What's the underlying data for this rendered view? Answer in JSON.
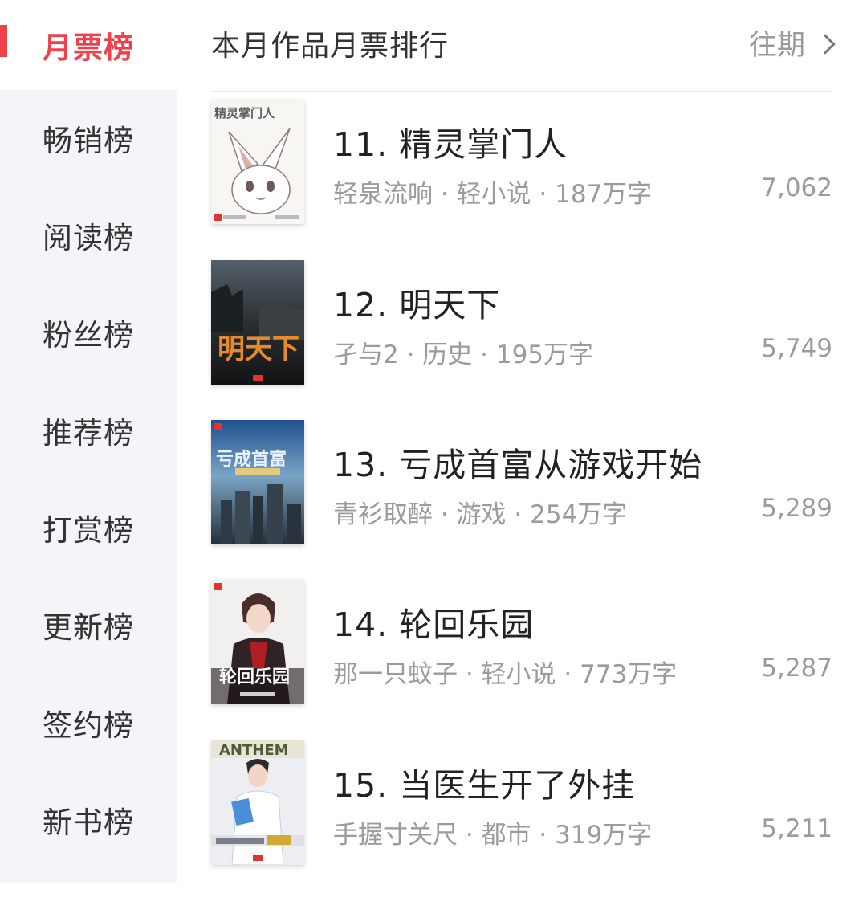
{
  "sidebar": {
    "items": [
      {
        "label": "月票榜",
        "active": true
      },
      {
        "label": "畅销榜"
      },
      {
        "label": "阅读榜"
      },
      {
        "label": "粉丝榜"
      },
      {
        "label": "推荐榜"
      },
      {
        "label": "打赏榜"
      },
      {
        "label": "更新榜"
      },
      {
        "label": "签约榜"
      },
      {
        "label": "新书榜"
      }
    ]
  },
  "header": {
    "title": "本月作品月票排行",
    "history_label": "往期"
  },
  "books": [
    {
      "title": "11. 精灵掌门人",
      "meta": "轻泉流响 · 轻小说 · 187万字",
      "votes": "7,062",
      "cover_text": "精灵掌门人"
    },
    {
      "title": "12. 明天下",
      "meta": "孑与2 · 历史 · 195万字",
      "votes": "5,749",
      "cover_text": "明天下"
    },
    {
      "title": "13. 亏成首富从游戏开始",
      "meta": "青衫取醉 · 游戏 · 254万字",
      "votes": "5,289",
      "cover_text": "亏成首富"
    },
    {
      "title": "14. 轮回乐园",
      "meta": "那一只蚊子 · 轻小说 · 773万字",
      "votes": "5,287",
      "cover_text": "轮回乐园"
    },
    {
      "title": "15. 当医生开了外挂",
      "meta": "手握寸关尺 · 都市 · 319万字",
      "votes": "5,211",
      "cover_text": "ANTHEM"
    }
  ],
  "colors": {
    "accent": "#ed424b",
    "sidebar_bg": "#f4f5f9",
    "text_primary": "#222222",
    "text_secondary": "#9b9b9b"
  }
}
